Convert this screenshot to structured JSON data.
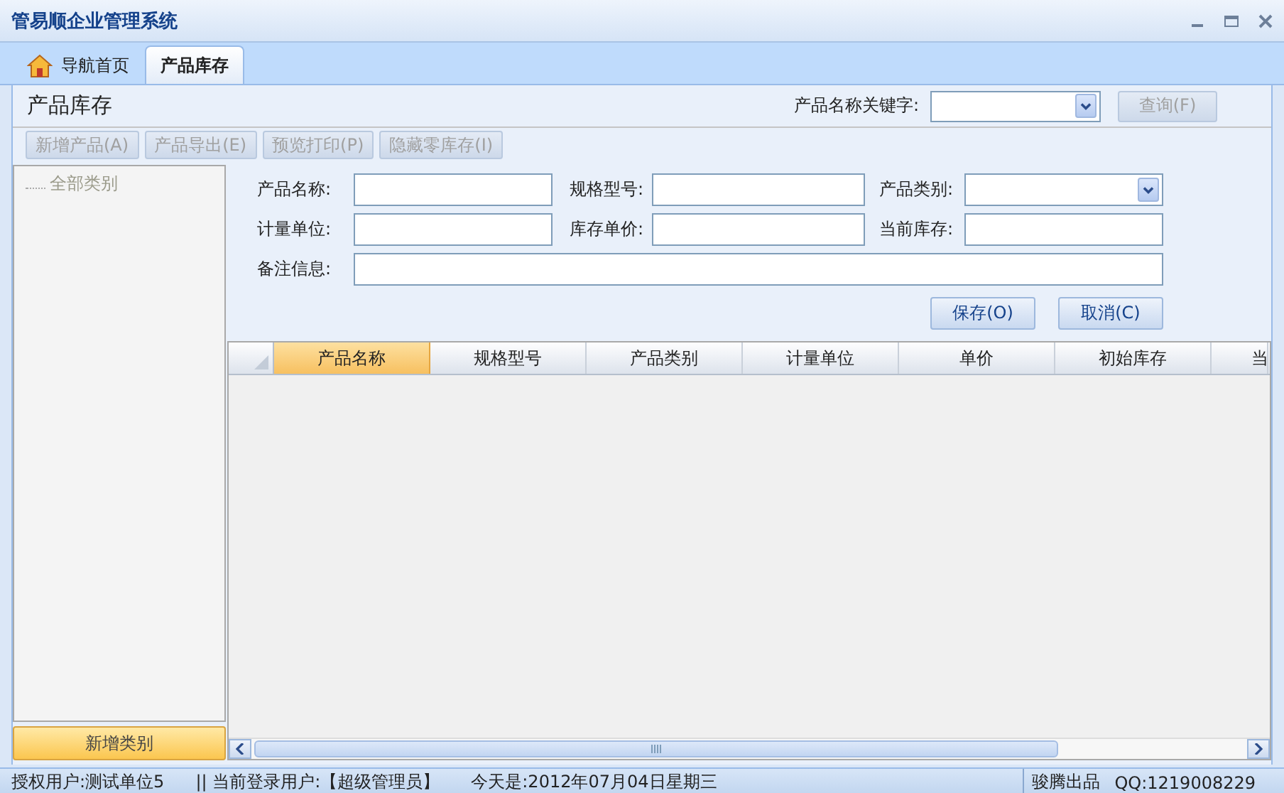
{
  "window": {
    "title": "管易顺企业管理系统"
  },
  "tabs": [
    {
      "label": "导航首页",
      "selected": false,
      "kind": "home"
    },
    {
      "label": "产品库存",
      "selected": true,
      "kind": "plain"
    }
  ],
  "page": {
    "title": "产品库存",
    "keyword_label": "产品名称关键字:",
    "query_button": {
      "label": "查询(F)",
      "disabled": true
    }
  },
  "toolbar": [
    {
      "label": "新增产品(A)",
      "disabled": true
    },
    {
      "label": "产品导出(E)",
      "disabled": true
    },
    {
      "label": "预览打印(P)",
      "disabled": true
    },
    {
      "label": "隐藏零库存(I)",
      "disabled": true
    }
  ],
  "sidebar": {
    "items": [
      {
        "label": "全部类别"
      }
    ],
    "button": "新增类别"
  },
  "form": {
    "fields": [
      {
        "label": "产品名称:",
        "kind": "text"
      },
      {
        "label": "规格型号:",
        "kind": "text"
      },
      {
        "label": "产品类别:",
        "kind": "combo"
      },
      {
        "label": "计量单位:",
        "kind": "text"
      },
      {
        "label": "库存单价:",
        "kind": "text"
      },
      {
        "label": "当前库存:",
        "kind": "text"
      },
      {
        "label": "备注信息:",
        "kind": "wide"
      }
    ],
    "buttons": [
      {
        "label": "保存(O)"
      },
      {
        "label": "取消(C)"
      }
    ]
  },
  "table": {
    "columns": [
      {
        "label": "产品名称",
        "selected": true
      },
      {
        "label": "规格型号",
        "selected": false
      },
      {
        "label": "产品类别",
        "selected": false
      },
      {
        "label": "计量单位",
        "selected": false
      },
      {
        "label": "单价",
        "selected": false
      },
      {
        "label": "初始库存",
        "selected": false
      },
      {
        "label": "当",
        "selected": false
      }
    ]
  },
  "status_bar": {
    "left": [
      "授权用户:测试单位5",
      "|| 当前登录用户:【超级管理员】",
      "今天是:2012年07月04日星期三"
    ],
    "right": [
      "骏腾出品",
      "QQ:1219008229"
    ]
  }
}
